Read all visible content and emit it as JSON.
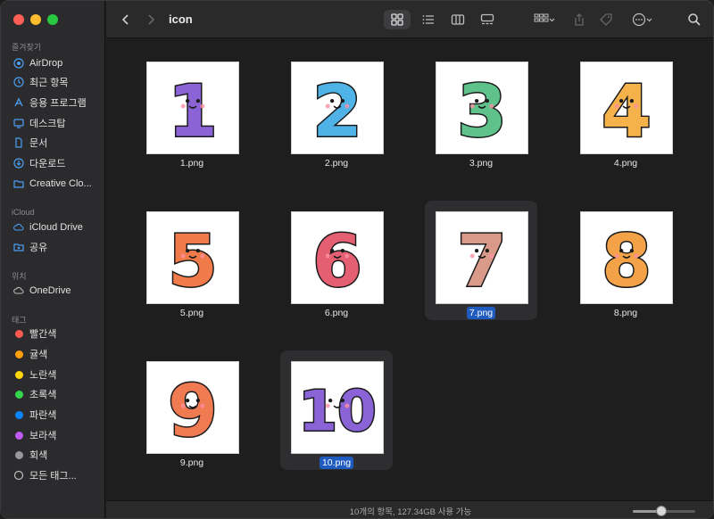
{
  "toolbar": {
    "title": "icon"
  },
  "sidebar": {
    "favorites_header": "즐겨찾기",
    "favorites": [
      {
        "label": "AirDrop",
        "icon": "airdrop-icon"
      },
      {
        "label": "최근 항목",
        "icon": "clock-icon"
      },
      {
        "label": "응용 프로그램",
        "icon": "applications-icon"
      },
      {
        "label": "데스크탑",
        "icon": "desktop-icon"
      },
      {
        "label": "문서",
        "icon": "document-icon"
      },
      {
        "label": "다운로드",
        "icon": "download-icon"
      },
      {
        "label": "Creative Clo...",
        "icon": "folder-icon"
      }
    ],
    "icloud_header": "iCloud",
    "icloud": [
      {
        "label": "iCloud Drive",
        "icon": "cloud-icon"
      },
      {
        "label": "공유",
        "icon": "shared-folder-icon"
      }
    ],
    "locations_header": "위치",
    "locations": [
      {
        "label": "OneDrive",
        "icon": "cloud-icon"
      }
    ],
    "tags_header": "태그",
    "tags": [
      {
        "label": "빨간색",
        "color": "#ff5a52"
      },
      {
        "label": "귤색",
        "color": "#ff9f0a"
      },
      {
        "label": "노란색",
        "color": "#ffd60a"
      },
      {
        "label": "초록색",
        "color": "#32d74b"
      },
      {
        "label": "파란색",
        "color": "#0a84ff"
      },
      {
        "label": "보라색",
        "color": "#bf5af2"
      },
      {
        "label": "회색",
        "color": "#98989d"
      },
      {
        "label": "모든 태그...",
        "icon": "all-tags-icon"
      }
    ]
  },
  "files": [
    {
      "name": "1.png",
      "digit": "1",
      "color": "#8b63d6",
      "selected": false
    },
    {
      "name": "2.png",
      "digit": "2",
      "color": "#4fb3e8",
      "selected": false
    },
    {
      "name": "3.png",
      "digit": "3",
      "color": "#5fc28a",
      "selected": false
    },
    {
      "name": "4.png",
      "digit": "4",
      "color": "#f5b24a",
      "selected": false
    },
    {
      "name": "5.png",
      "digit": "5",
      "color": "#f07a4a",
      "selected": false
    },
    {
      "name": "6.png",
      "digit": "6",
      "color": "#e55f72",
      "selected": false
    },
    {
      "name": "7.png",
      "digit": "7",
      "color": "#d99a8a",
      "selected": true
    },
    {
      "name": "8.png",
      "digit": "8",
      "color": "#f3a247",
      "selected": false
    },
    {
      "name": "9.png",
      "digit": "9",
      "color": "#f07a52",
      "selected": false
    },
    {
      "name": "10.png",
      "digit": "10",
      "color": "#8a63d6",
      "selected": true
    }
  ],
  "status": {
    "text": "10개의 항목, 127.34GB 사용 가능",
    "zoom_level": 0.45
  },
  "colors": {
    "accent": "#1f5bbf",
    "sidebar_icon": "#4aa0f5"
  }
}
